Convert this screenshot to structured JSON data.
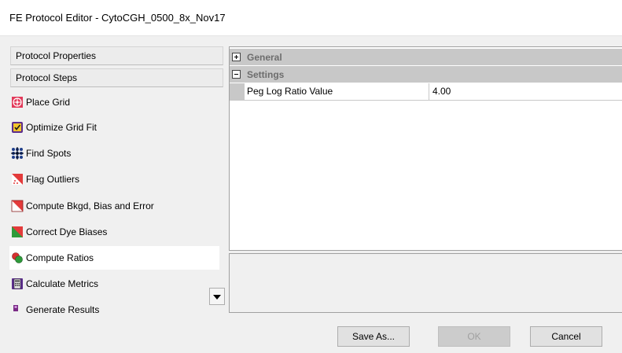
{
  "window": {
    "title": "FE Protocol Editor - CytoCGH_0500_8x_Nov17"
  },
  "left_panel": {
    "sections": [
      {
        "label": "Protocol Properties"
      },
      {
        "label": "Protocol Steps"
      }
    ],
    "steps": [
      {
        "label": "Place Grid",
        "icon": "place-grid-icon"
      },
      {
        "label": "Optimize Grid Fit",
        "icon": "optimize-grid-icon"
      },
      {
        "label": "Find Spots",
        "icon": "find-spots-icon"
      },
      {
        "label": "Flag Outliers",
        "icon": "flag-outliers-icon"
      },
      {
        "label": "Compute Bkgd, Bias and Error",
        "icon": "compute-bkgd-icon"
      },
      {
        "label": "Correct Dye Biases",
        "icon": "correct-dye-icon"
      },
      {
        "label": "Compute Ratios",
        "icon": "compute-ratios-icon",
        "selected": true
      },
      {
        "label": "Calculate Metrics",
        "icon": "calculate-metrics-icon"
      },
      {
        "label": "Generate Results",
        "icon": "generate-results-icon"
      }
    ],
    "scroll_icon": "chevron-down-icon"
  },
  "property_grid": {
    "categories": [
      {
        "label": "General",
        "expanded": false
      },
      {
        "label": "Settings",
        "expanded": true
      }
    ],
    "properties": [
      {
        "name": "Peg Log Ratio Value",
        "value": "4.00"
      }
    ]
  },
  "buttons": {
    "save_as": "Save As...",
    "ok": "OK",
    "cancel": "Cancel"
  },
  "colors": {
    "category_band": "#c8c8c8",
    "category_text": "#6d6d6d",
    "selected_step_bg": "#ffffff"
  }
}
